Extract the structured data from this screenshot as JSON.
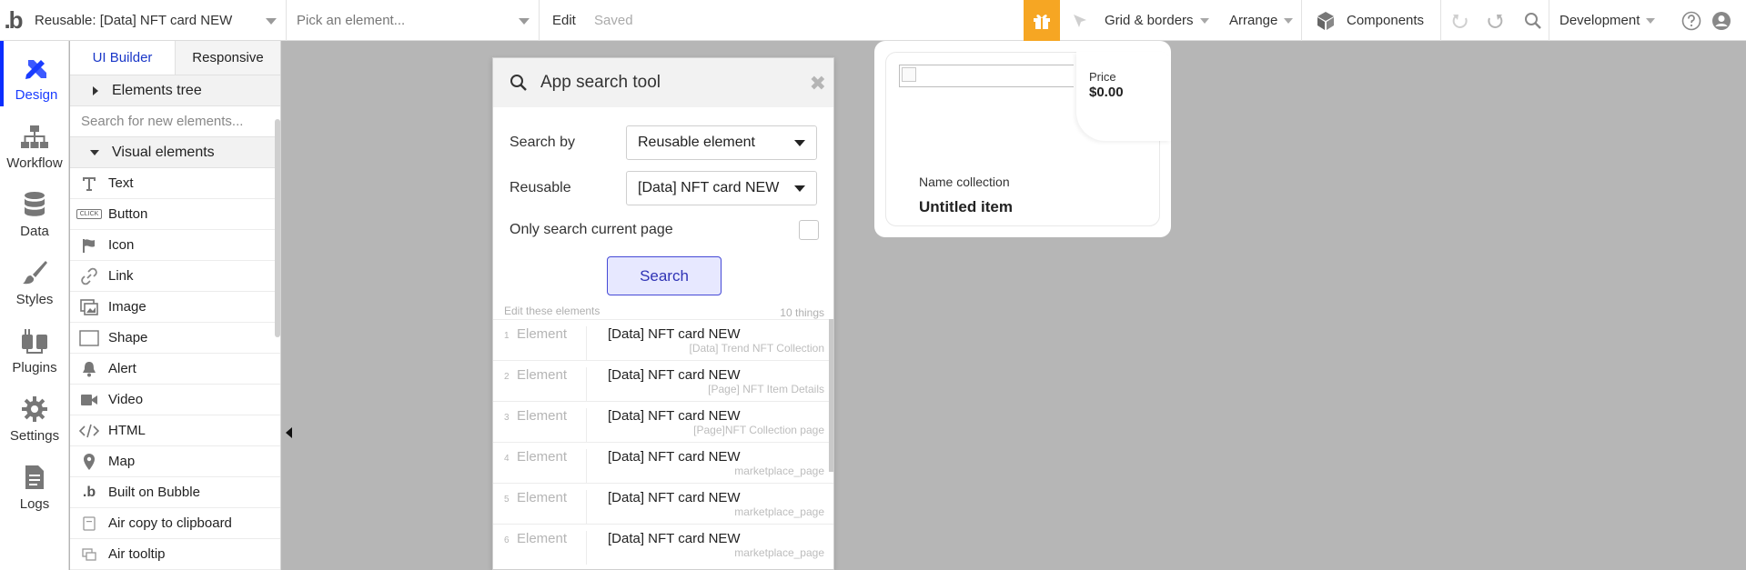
{
  "topbar": {
    "logo": "b",
    "reusable_title": "Reusable: [Data] NFT card NEW",
    "pick_placeholder": "Pick an element...",
    "edit_label": "Edit",
    "saved_label": "Saved",
    "grid_label": "Grid & borders",
    "arrange_label": "Arrange",
    "components_label": "Components",
    "env_label": "Development",
    "accent_color": "#f6a623"
  },
  "leftnav": {
    "items": [
      {
        "label": "Design",
        "icon": "design-icon"
      },
      {
        "label": "Workflow",
        "icon": "workflow-icon"
      },
      {
        "label": "Data",
        "icon": "database-icon"
      },
      {
        "label": "Styles",
        "icon": "brush-icon"
      },
      {
        "label": "Plugins",
        "icon": "plug-icon"
      },
      {
        "label": "Settings",
        "icon": "gear-icon"
      },
      {
        "label": "Logs",
        "icon": "document-icon"
      }
    ],
    "active_color": "#0b2dff"
  },
  "panel": {
    "tabs": [
      "UI Builder",
      "Responsive"
    ],
    "elements_tree": "Elements tree",
    "search_placeholder": "Search for new elements...",
    "visual_elements": "Visual elements",
    "items": [
      {
        "label": "Text",
        "icon": "text-icon"
      },
      {
        "label": "Button",
        "icon": "button-icon"
      },
      {
        "label": "Icon",
        "icon": "flag-icon"
      },
      {
        "label": "Link",
        "icon": "link-icon"
      },
      {
        "label": "Image",
        "icon": "image-icon"
      },
      {
        "label": "Shape",
        "icon": "shape-icon"
      },
      {
        "label": "Alert",
        "icon": "bell-icon"
      },
      {
        "label": "Video",
        "icon": "video-icon"
      },
      {
        "label": "HTML",
        "icon": "code-icon"
      },
      {
        "label": "Map",
        "icon": "map-pin-icon"
      },
      {
        "label": "Built on Bubble",
        "icon": "bubble-logo-icon"
      },
      {
        "label": "Air copy to clipboard",
        "icon": "clipboard-icon"
      },
      {
        "label": "Air tooltip",
        "icon": "tooltip-icon"
      }
    ],
    "button_icon_text": "CLICK"
  },
  "search_tool": {
    "title": "App search tool",
    "search_by_label": "Search by",
    "search_by_value": "Reusable element",
    "reusable_label": "Reusable",
    "reusable_value": "[Data] NFT card NEW",
    "only_current_label": "Only search current page",
    "search_button": "Search",
    "edit_these": "Edit these elements",
    "count_label": "10 things",
    "results": [
      {
        "n": "1",
        "type": "Element",
        "value": "[Data] NFT card NEW",
        "source": "[Data] Trend NFT Collection"
      },
      {
        "n": "2",
        "type": "Element",
        "value": "[Data] NFT card NEW",
        "source": "[Page] NFT Item Details"
      },
      {
        "n": "3",
        "type": "Element",
        "value": "[Data] NFT card NEW",
        "source": "[Page]NFT Collection page"
      },
      {
        "n": "4",
        "type": "Element",
        "value": "[Data] NFT card NEW",
        "source": "marketplace_page"
      },
      {
        "n": "5",
        "type": "Element",
        "value": "[Data] NFT card NEW",
        "source": "marketplace_page"
      },
      {
        "n": "6",
        "type": "Element",
        "value": "[Data] NFT card NEW",
        "source": "marketplace_page"
      }
    ],
    "button_accent": "#4549d6"
  },
  "card": {
    "price_label": "Price",
    "price_value": "$0.00",
    "collection_label": "Name collection",
    "item_name": "Untitled item"
  }
}
